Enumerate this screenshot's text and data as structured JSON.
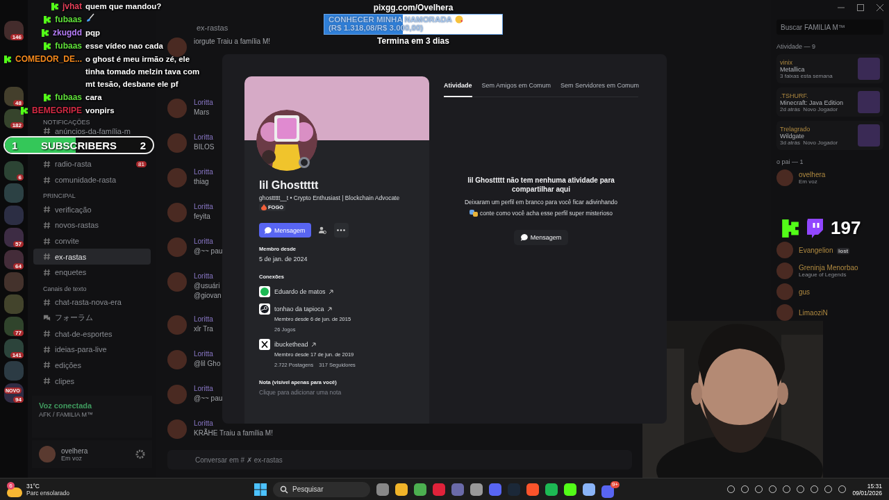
{
  "discord": {
    "servers": [
      {
        "kind": "server",
        "badge": "146"
      },
      {
        "kind": "server",
        "badge": "48"
      },
      {
        "kind": "server",
        "badge": "182"
      },
      {
        "kind": "server",
        "badge": "6"
      },
      {
        "kind": "server"
      },
      {
        "kind": "server"
      },
      {
        "kind": "server",
        "badge": "57"
      },
      {
        "kind": "server",
        "badge": "64"
      },
      {
        "kind": "server"
      },
      {
        "kind": "server"
      },
      {
        "kind": "server",
        "badge": "77"
      },
      {
        "kind": "server",
        "badge": "141"
      },
      {
        "kind": "server"
      },
      {
        "kind": "server",
        "badge": "94",
        "label": "NOVO"
      }
    ],
    "channels": [
      {
        "kind": "category",
        "name": "NOTIFICAÇÕES"
      },
      {
        "kind": "text",
        "name": "anúncios-da-família-m",
        "selected": false
      },
      {
        "kind": "text",
        "name": "radio-rasta",
        "badge": "81",
        "selected": false
      },
      {
        "kind": "text",
        "name": "comunidade-rasta",
        "selected": false
      },
      {
        "kind": "category",
        "name": "PRINCIPAL"
      },
      {
        "kind": "text",
        "name": "verificação",
        "selected": false
      },
      {
        "kind": "text",
        "name": "novos-rastas",
        "selected": false
      },
      {
        "kind": "text",
        "name": "convite",
        "selected": false
      },
      {
        "kind": "text",
        "name": "ex-rastas",
        "selected": true
      },
      {
        "kind": "text",
        "name": "enquetes",
        "selected": false
      },
      {
        "kind": "category",
        "name": "Canais de texto"
      },
      {
        "kind": "text",
        "name": "chat-rasta-nova-era",
        "selected": false
      },
      {
        "kind": "forum",
        "name": "フォーラム",
        "selected": false
      },
      {
        "kind": "text",
        "name": "chat-de-esportes",
        "selected": false
      },
      {
        "kind": "text",
        "name": "ideias-para-live",
        "selected": false
      },
      {
        "kind": "text",
        "name": "edições",
        "selected": false
      },
      {
        "kind": "text",
        "name": "clipes",
        "selected": false
      }
    ],
    "voice": {
      "status": "Voz conectada",
      "channel": "AFK / FAMILIA M™"
    },
    "user": {
      "name": "ovelhera",
      "status": "Em voz"
    },
    "chat": {
      "channel": "ex-rastas",
      "placeholder": "Conversar em # ✗ ex-rastas",
      "messages": [
        {
          "text": "iorgute Traiu a família M!"
        },
        {
          "author": "Loritta",
          "text": "Mars"
        },
        {
          "author": "Loritta",
          "text": "BILOS"
        },
        {
          "author": "Loritta",
          "text": "thiag"
        },
        {
          "author": "Loritta",
          "text": "feyita"
        },
        {
          "author": "Loritta",
          "text": "@~~ pau"
        },
        {
          "author": "Loritta",
          "text": "@usuári",
          "extra": "@giovan"
        },
        {
          "author": "Loritta",
          "text": "xlr Tra"
        },
        {
          "author": "Loritta",
          "text": "@lil Gho"
        },
        {
          "author": "Loritta",
          "text": "@~~ pau"
        },
        {
          "author": "Loritta",
          "text": "KRÃHE Traiu a família M!"
        }
      ]
    },
    "members": {
      "search": "Buscar FAMILIA M™",
      "activity_header": "Atividade — 9",
      "activity": [
        {
          "user": "vinix",
          "title": "Metallica",
          "detail": "3 faixas esta semana"
        },
        {
          "user": ".TSHURF.",
          "title": "Minecraft: Java Edition",
          "detail": "2d atrás",
          "tag": "Novo Jogador"
        },
        {
          "user": "Trelagrado",
          "title": "Wildgate",
          "detail": "3d atrás",
          "tag": "Novo Jogador"
        }
      ],
      "group": "o pai — 1",
      "list": [
        {
          "name": "ovelhera",
          "status": "Em voz"
        },
        {
          "name": "Evangelion",
          "badge": "lost"
        },
        {
          "name": "Greninja Menorbao",
          "status": "League of Legends"
        },
        {
          "name": "gus"
        },
        {
          "name": "LimaoziN"
        }
      ]
    }
  },
  "overlay": {
    "chat": [
      {
        "kind": "text",
        "user": "jvhat",
        "color": "#e8405a",
        "text": "quem que mandou?"
      },
      {
        "kind": "emote",
        "user": "fubaas",
        "color": "#5fe03a"
      },
      {
        "kind": "text",
        "user": "zkugdd",
        "color": "#b57cf6",
        "text": "pqp"
      },
      {
        "kind": "text",
        "user": "fubaas",
        "color": "#5fe03a",
        "text": "esse vídeo nao cada"
      },
      {
        "kind": "text",
        "user": "COMEDOR_DE...",
        "color": "#f5891c",
        "text": "o ghost é meu irmão zé, ele tinha tomado melzin tava com mt tesão, desbane ele pf"
      },
      {
        "kind": "text",
        "user": "fubaas",
        "color": "#5fe03a",
        "text": "cara"
      },
      {
        "kind": "text",
        "user": "BEMEGRIPE",
        "color": "#d42a44",
        "text": "vonpirs"
      }
    ],
    "subscribers": {
      "start": "1",
      "label": "SUBSCRIBERS",
      "end": "2",
      "level": 0.48
    },
    "goal": {
      "url": "pixgg.com/Ovelhera",
      "title": "CONHECER MINHA NAMORADA",
      "amount": "(R$ 1.318,08/R$ 3.000,00)",
      "level": 0.44,
      "ends": "Termina em 3 dias"
    },
    "viewers": "197"
  },
  "profile": {
    "name": "lil Ghosttttt",
    "subtitle": "ghosttttt__t • Crypto Enthusiast | Blockchain Advocate",
    "tag": "FOGO",
    "message_button": "Mensagem",
    "member_since_label": "Membro desde",
    "member_since": "5 de jan. de 2024",
    "connections_label": "Conexões",
    "connections": [
      {
        "kind": "spotify",
        "name": "Eduardo de matos"
      },
      {
        "kind": "steam",
        "name": "tonhao da tapioca",
        "since": "Membro desde 6 de jun. de 2015",
        "stats": [
          "26 Jogos"
        ]
      },
      {
        "kind": "x",
        "name": "ibuckethead",
        "since": "Membro desde 17 de jun. de 2019",
        "stats": [
          "2.722 Postagens",
          "317 Seguidores"
        ]
      }
    ],
    "note_label": "Nota (visível apenas para você)",
    "note_placeholder": "Clique para adicionar uma nota",
    "tabs": [
      {
        "label": "Atividade",
        "selected": true
      },
      {
        "label": "Sem Amigos em Comum",
        "selected": false
      },
      {
        "label": "Sem Servidores em Comum",
        "selected": false
      }
    ],
    "empty_title": "lil Ghosttttt não tem nenhuma atividade para compartilhar aqui",
    "empty_text_1": "Deixaram um perfil em branco para você ficar adivinhando",
    "empty_text_2": "conte como você acha esse perfil super misterioso",
    "empty_button": "Mensagem"
  },
  "taskbar": {
    "temperature": "31°C",
    "weather": "Parc ensolarado",
    "weather_badge": "6",
    "search": "Pesquisar",
    "discord_badge": "9+",
    "time": "15:31",
    "date": "09/01/2026"
  }
}
